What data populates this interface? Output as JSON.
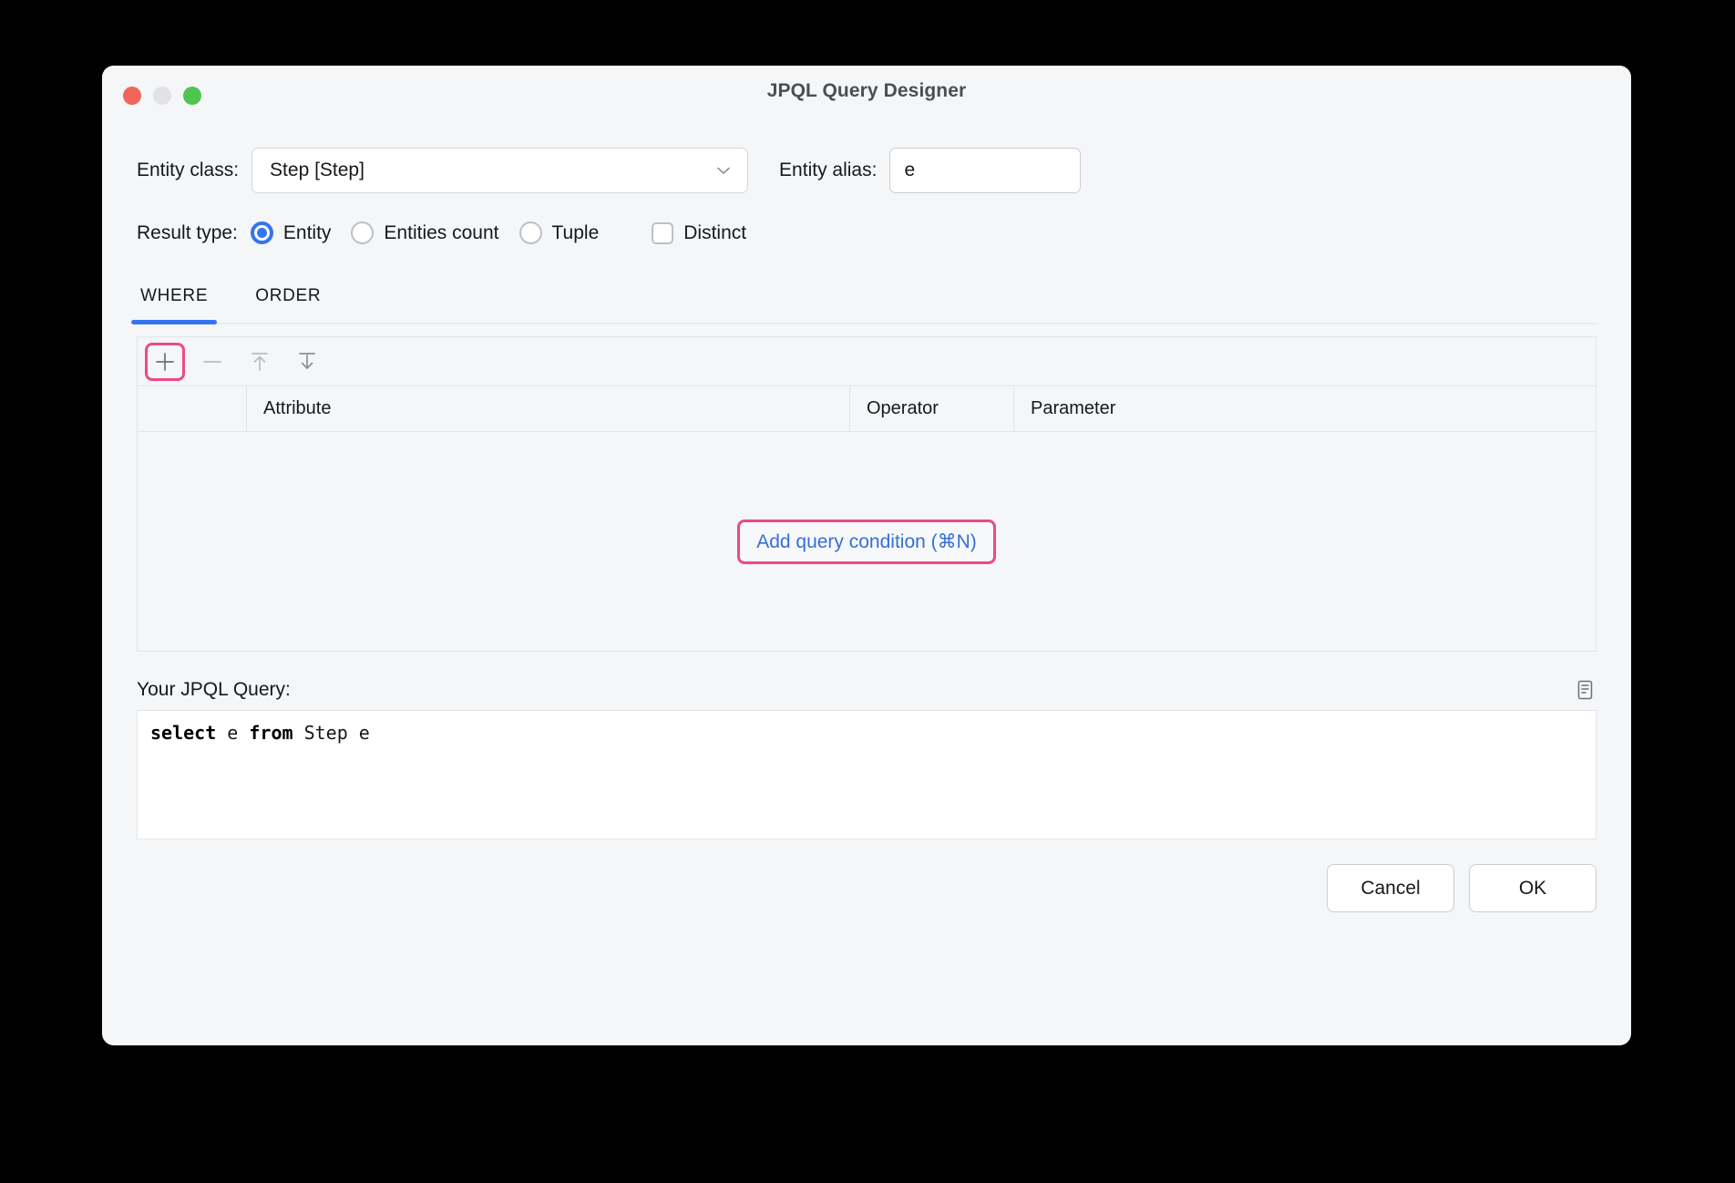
{
  "window": {
    "title": "JPQL Query Designer",
    "traffic_lights": [
      "close",
      "minimize",
      "zoom"
    ]
  },
  "form": {
    "entity_class_label": "Entity class:",
    "entity_class_value": "Step [Step]",
    "entity_alias_label": "Entity alias:",
    "entity_alias_value": "e",
    "result_type_label": "Result type:",
    "result_options": [
      {
        "label": "Entity",
        "selected": true
      },
      {
        "label": "Entities count",
        "selected": false
      },
      {
        "label": "Tuple",
        "selected": false
      }
    ],
    "distinct_label": "Distinct",
    "distinct_checked": false
  },
  "tabs": [
    {
      "label": "WHERE",
      "active": true
    },
    {
      "label": "ORDER",
      "active": false
    }
  ],
  "toolbar": {
    "add_icon": "plus-icon",
    "remove_icon": "minus-icon",
    "move_up_icon": "move-up-icon",
    "move_down_icon": "move-down-icon"
  },
  "conditions_table": {
    "columns": [
      "",
      "Attribute",
      "Operator",
      "Parameter"
    ],
    "rows": [],
    "empty_action_label": "Add query condition (⌘N)"
  },
  "query": {
    "label": "Your JPQL Query:",
    "copy_icon": "copy-icon",
    "text_parts": [
      {
        "text": "select",
        "keyword": true
      },
      {
        "text": " e ",
        "keyword": false
      },
      {
        "text": "from",
        "keyword": true
      },
      {
        "text": " Step e",
        "keyword": false
      }
    ],
    "full_text": "select e from Step e"
  },
  "footer": {
    "cancel_label": "Cancel",
    "ok_label": "OK"
  },
  "colors": {
    "accent_blue": "#3574f0",
    "link_blue": "#3470d4",
    "highlight_pink": "#ec4a83",
    "window_bg": "#f5f6f8"
  }
}
